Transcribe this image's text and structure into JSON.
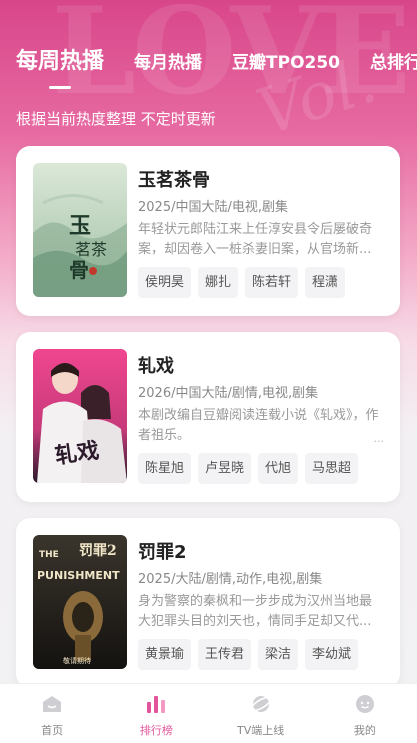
{
  "tabs": [
    {
      "label": "每周热播",
      "active": true
    },
    {
      "label": "每月热播",
      "active": false
    },
    {
      "label": "豆瓣TPO250",
      "active": false
    },
    {
      "label": "总排行",
      "active": false
    }
  ],
  "subtitle": "根据当前热度整理 不定时更新",
  "decor_text": "LOVE",
  "items": [
    {
      "title": "玉茗茶骨",
      "meta": "2025/中国大陆/电视,剧集",
      "desc": "年轻状元郎陆江来上任淳安县令后屡破奇案，却因卷入一桩杀妻旧案，从官场新...",
      "actors": [
        "侯明昊",
        "娜扎",
        "陈若轩",
        "程潇"
      ],
      "poster_text": "玉茗茶骨",
      "poster_colors": [
        "#cfe0cf",
        "#7fa58a"
      ]
    },
    {
      "title": "轧戏",
      "meta": "2026/中国大陆/剧情,电视,剧集",
      "desc": "本剧改编自豆瓣阅读连载小说《轧戏》，作者祖乐。",
      "more": "...",
      "actors": [
        "陈星旭",
        "卢昱晓",
        "代旭",
        "马思超"
      ],
      "poster_text": "轧戏",
      "poster_colors": [
        "#e8478d",
        "#3a1f3a"
      ]
    },
    {
      "title": "罚罪2",
      "meta": "2025/大陆/剧情,动作,电视,剧集",
      "desc": "身为警察的秦枫和一步步成为汉州当地最大犯罪头目的刘天也，情同手足却又代...",
      "actors": [
        "黄景瑜",
        "王传君",
        "梁洁",
        "李幼斌"
      ],
      "poster_text": "罚罪2",
      "poster_sub": "THE PUNISHMENT",
      "poster_colors": [
        "#2a2620",
        "#8a6a3a"
      ]
    }
  ],
  "nav": [
    {
      "label": "首页",
      "icon": "home-icon",
      "active": false
    },
    {
      "label": "排行榜",
      "icon": "ranking-icon",
      "active": true
    },
    {
      "label": "TV端上线",
      "icon": "planet-icon",
      "active": false
    },
    {
      "label": "我的",
      "icon": "profile-icon",
      "active": false
    }
  ],
  "colors": {
    "accent": "#e2559a",
    "header": "#d8468a"
  }
}
